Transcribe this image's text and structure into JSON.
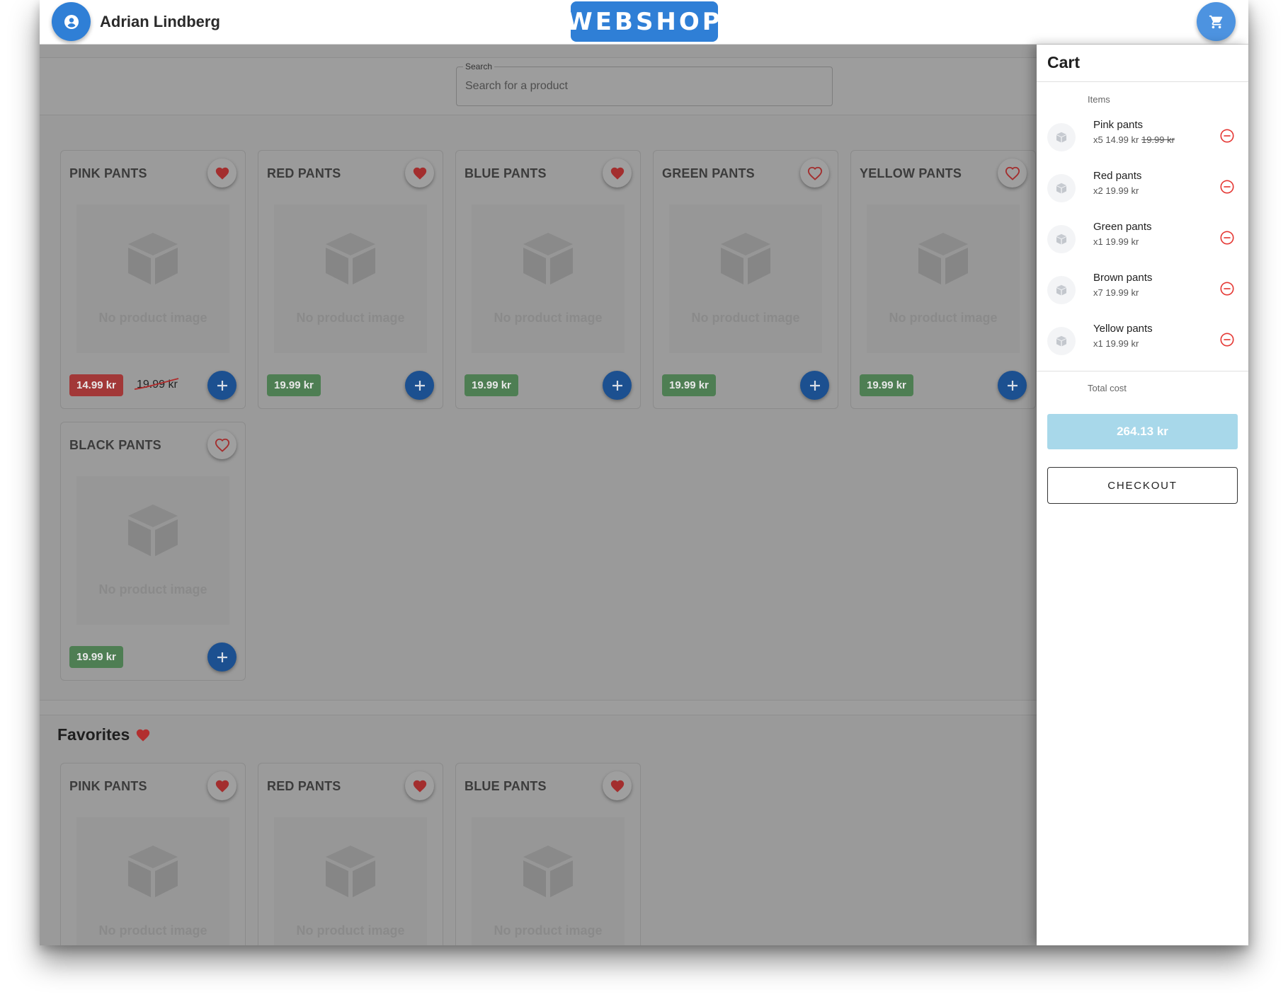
{
  "header": {
    "user_name": "Adrian Lindberg",
    "logo_text": "WEBSHOP",
    "avatar_icon": "account-circle-icon",
    "cart_icon": "shopping-cart-icon",
    "accent_color": "#2f7fd6"
  },
  "search": {
    "label": "Search",
    "placeholder": "Search for a product"
  },
  "products": [
    {
      "title": "PINK PANTS",
      "favorited": true,
      "no_image_text": "No product image",
      "price": "14.99 kr",
      "old_price": "19.99 kr",
      "on_sale": true
    },
    {
      "title": "RED PANTS",
      "favorited": true,
      "no_image_text": "No product image",
      "price": "19.99 kr",
      "on_sale": false
    },
    {
      "title": "BLUE PANTS",
      "favorited": true,
      "no_image_text": "No product image",
      "price": "19.99 kr",
      "on_sale": false
    },
    {
      "title": "GREEN PANTS",
      "favorited": false,
      "no_image_text": "No product image",
      "price": "19.99 kr",
      "on_sale": false
    },
    {
      "title": "YELLOW PANTS",
      "favorited": false,
      "no_image_text": "No product image",
      "price": "19.99 kr",
      "on_sale": false
    },
    {
      "title": "BLACK PANTS",
      "favorited": false,
      "no_image_text": "No product image",
      "price": "19.99 kr",
      "on_sale": false
    }
  ],
  "favorites": {
    "heading": "Favorites",
    "items": [
      {
        "title": "PINK PANTS",
        "favorited": true,
        "no_image_text": "No product image"
      },
      {
        "title": "RED PANTS",
        "favorited": true,
        "no_image_text": "No product image"
      },
      {
        "title": "BLUE PANTS",
        "favorited": true,
        "no_image_text": "No product image"
      }
    ]
  },
  "cart": {
    "title": "Cart",
    "items_label": "Items",
    "items": [
      {
        "name": "Pink pants",
        "qty": "x5",
        "price": "14.99 kr",
        "old_price": "19.99 kr"
      },
      {
        "name": "Red pants",
        "qty": "x2",
        "price": "19.99 kr"
      },
      {
        "name": "Green pants",
        "qty": "x1",
        "price": "19.99 kr"
      },
      {
        "name": "Brown pants",
        "qty": "x7",
        "price": "19.99 kr"
      },
      {
        "name": "Yellow pants",
        "qty": "x1",
        "price": "19.99 kr"
      }
    ],
    "total_label": "Total cost",
    "total": "264.13 kr",
    "checkout_label": "CHECKOUT"
  },
  "colors": {
    "sale_badge": "#a23838",
    "price_badge": "#4e7e53",
    "add_button": "#1c5090",
    "heart": "#c0392b",
    "total_box": "#a8d8ea",
    "remove_icon": "#e53935"
  }
}
